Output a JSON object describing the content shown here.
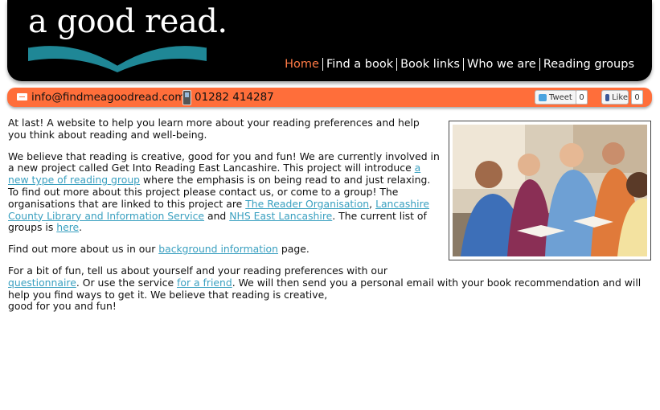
{
  "logo": {
    "text": "a good read."
  },
  "nav": {
    "items": [
      {
        "label": "Home",
        "active": true
      },
      {
        "label": "Find a book"
      },
      {
        "label": "Book links"
      },
      {
        "label": "Who we are"
      },
      {
        "label": "Reading groups"
      }
    ]
  },
  "contact": {
    "email": "info@findmeagoodread.com",
    "phone": "01282 414287",
    "tweet_label": "Tweet",
    "tweet_count": "0",
    "like_label": "Like",
    "like_count": "0"
  },
  "content": {
    "p1": "At last! A website to help you learn more about your reading preferences and help you think about reading and well-being.",
    "p2": {
      "t1": "We believe that reading is creative, good for you and fun! We are currently involved in a new project called Get Into Reading East Lancashire. This project will introduce ",
      "link1": "a new type of reading group",
      "t2": " where the emphasis is on being read to and just relaxing. To find out more about this project please contact us, or come to a group! The organisations that are linked to this project are ",
      "link2": "The Reader Organisation",
      "t3": ", ",
      "link3": "Lancashire County Library and Information Service",
      "t4": " and ",
      "link4": "NHS East Lancashire",
      "t5": ". The current list of groups is ",
      "link5": "here",
      "t6": "."
    },
    "p3": {
      "t1": "Find out more about us in our ",
      "link": "background information",
      "t2": " page."
    },
    "p4": {
      "t1": "For a bit of fun, tell us about yourself and your reading preferences with our ",
      "link1": "questionnaire",
      "t2": ". Or use the service ",
      "link2": "for a friend",
      "t3": ". We will then send you a personal email with your book recommendation and will help you find ways to get it. We believe that reading is creative,",
      "t4": "good for you and fun!"
    }
  },
  "colors": {
    "accent": "#ff6e3a",
    "link": "#3aa0c0",
    "teal": "#1f8796"
  },
  "icons": [
    "mail-icon",
    "phone-icon",
    "twitter-icon",
    "facebook-icon",
    "book-logo-icon"
  ]
}
